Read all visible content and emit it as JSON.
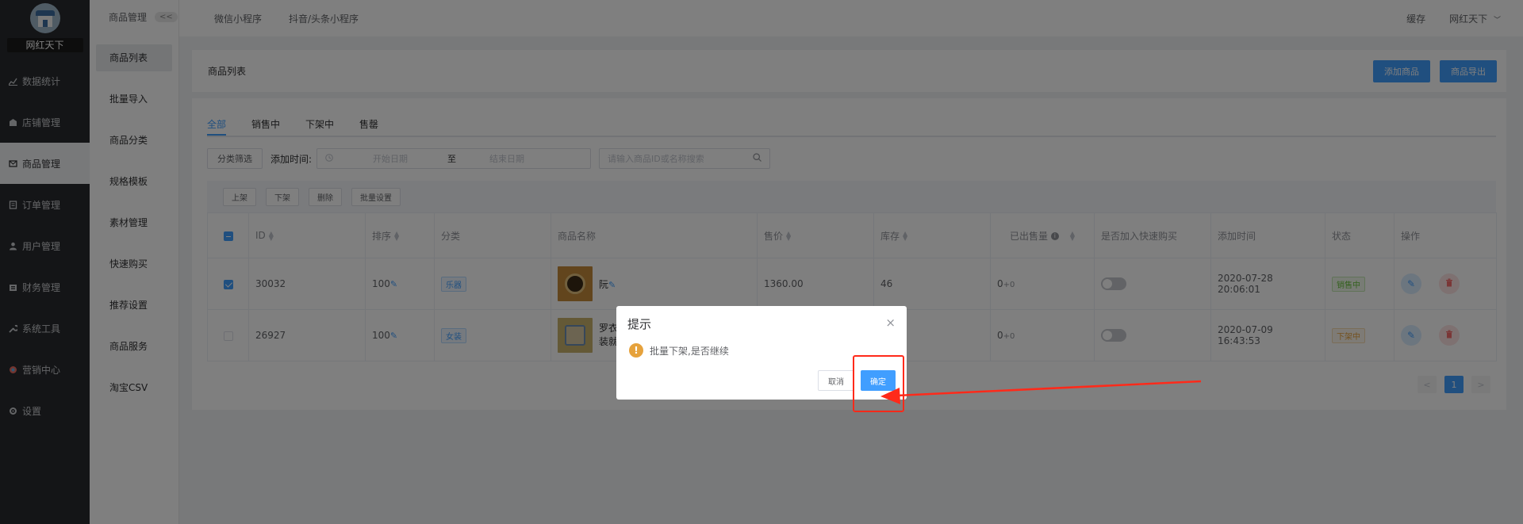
{
  "sidebar": {
    "shop_name": "网红天下",
    "items": [
      {
        "label": "数据统计",
        "icon": "chart-icon"
      },
      {
        "label": "店铺管理",
        "icon": "store-icon"
      },
      {
        "label": "商品管理",
        "icon": "goods-icon"
      },
      {
        "label": "订单管理",
        "icon": "order-icon"
      },
      {
        "label": "用户管理",
        "icon": "user-icon"
      },
      {
        "label": "财务管理",
        "icon": "finance-icon"
      },
      {
        "label": "系统工具",
        "icon": "wrench-icon"
      },
      {
        "label": "营销中心",
        "icon": "marketing-icon"
      },
      {
        "label": "设置",
        "icon": "gear-icon"
      }
    ],
    "active_index": 2
  },
  "subnav": {
    "title": "商品管理",
    "collapse_label": "<<",
    "items": [
      "商品列表",
      "批量导入",
      "商品分类",
      "规格模板",
      "素材管理",
      "快速购买",
      "推荐设置",
      "商品服务",
      "淘宝CSV"
    ]
  },
  "topbar": {
    "tab_mini_program": "微信小程序",
    "tab_douyin": "抖音/头条小程序",
    "cache": "缓存",
    "user": "网红天下",
    "user_caret": "﹀"
  },
  "page": {
    "title": "商品列表",
    "add_button": "添加商品",
    "export_button": "商品导出"
  },
  "tabs": [
    "全部",
    "销售中",
    "下架中",
    "售罄"
  ],
  "filters": {
    "category_button": "分类筛选",
    "added_time_label": "添加时间:",
    "date_start_placeholder": "开始日期",
    "date_separator": "至",
    "date_end_placeholder": "结束日期",
    "search_placeholder": "请输入商品ID或名称搜索"
  },
  "batch": {
    "up": "上架",
    "down": "下架",
    "delete": "删除",
    "settings": "批量设置"
  },
  "table": {
    "headers": {
      "id": "ID",
      "sort": "排序",
      "category": "分类",
      "name": "商品名称",
      "price": "售价",
      "stock": "库存",
      "sold": "已出售量",
      "quick_buy": "是否加入快速购买",
      "added_time": "添加时间",
      "status": "状态",
      "actions": "操作"
    },
    "rows": [
      {
        "id": "30032",
        "sort": "100",
        "category": "乐器",
        "name": "阮",
        "price": "1360.00",
        "stock": "46",
        "sold": "0",
        "sold_plus": "+0",
        "added_time": "2020-07-28 20:06:01",
        "status": "销售中",
        "checked": true
      },
      {
        "id": "26927",
        "sort": "100",
        "category": "女装",
        "name_line1": "罗衣",
        "name_line2": "装就",
        "price": "",
        "stock": "",
        "sold": "0",
        "sold_plus": "+0",
        "added_time": "2020-07-09 16:43:53",
        "status": "下架中",
        "checked": false
      }
    ]
  },
  "pagination": {
    "prev": "<",
    "current": "1",
    "next": ">"
  },
  "dialog": {
    "title": "提示",
    "message": "批量下架,是否继续",
    "cancel": "取消",
    "confirm": "确定",
    "close": "×",
    "warn_glyph": "!"
  },
  "annotation": {
    "color": "#ff2a1a"
  },
  "colors": {
    "primary": "#409eff",
    "sidebar_bg": "#282b2e",
    "warning": "#e6a23c",
    "danger": "#f56c6c"
  }
}
